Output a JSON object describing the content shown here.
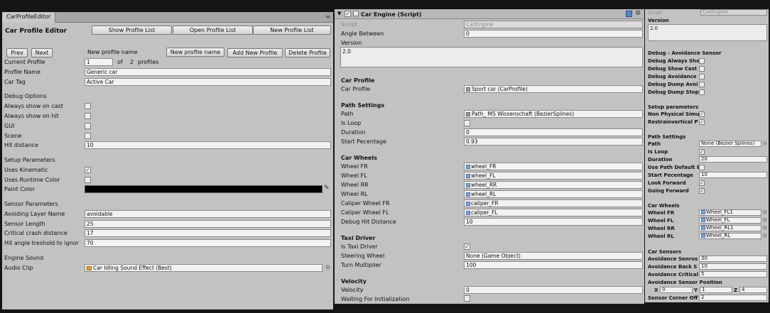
{
  "left": {
    "tab_title": "CarProfileEditor",
    "title": "Car Profile Editor",
    "buttons": {
      "show_list": "Show Profile List",
      "open_list": "Open Profile List",
      "new_list": "New Profile List",
      "prev": "Prev",
      "next": "Next",
      "new_name_field": "New profile name",
      "add_new": "Add New Profile",
      "delete": "Delete Profile"
    },
    "new_profile_name_label": "New profile name",
    "current_profile": {
      "label": "Current Profile",
      "value": "1",
      "of": "of",
      "total": "2",
      "suffix": "profiles"
    },
    "profile_name": {
      "label": "Profile Name",
      "value": "Generic car"
    },
    "car_tag": {
      "label": "Car Tag",
      "value": "Active Car"
    },
    "debug_header": "Debug Options",
    "debug": [
      {
        "label": "Always show on cast",
        "checked": false
      },
      {
        "label": "Always show on hit",
        "checked": false
      },
      {
        "label": "GUI",
        "checked": false
      },
      {
        "label": "Scene",
        "checked": false
      }
    ],
    "hit_distance": {
      "label": "Hit distance",
      "value": "10"
    },
    "setup_header": "Setup Parameters",
    "uses_kinematic": {
      "label": "Uses Kinematic",
      "checked": true
    },
    "uses_runtime_color": {
      "label": "Uses Runtime Color",
      "checked": false
    },
    "paint_color": {
      "label": "Paint Color",
      "color": "#000000"
    },
    "sensor_header": "Sensor Parameters",
    "sensor": [
      {
        "label": "Avoiding Layer Name",
        "value": "avoidable"
      },
      {
        "label": "Sensor Length",
        "value": "25"
      },
      {
        "label": "Critical crash distance",
        "value": "17"
      },
      {
        "label": "Hit angle treshold to ignor",
        "value": "70"
      }
    ],
    "engine_header": "Engine Sound",
    "audio_clip": {
      "label": "Audio Clip",
      "value": "Car Idling Sound Effect (Best)"
    }
  },
  "mid": {
    "component_title": "Car Engine (Script)",
    "script": {
      "label": "Script",
      "value": "CarEngine"
    },
    "angle_between": {
      "label": "Angle Between",
      "value": "0"
    },
    "version_label": "Version",
    "version_value": "2.0",
    "car_profile_header": "Car Profile",
    "car_profile": {
      "label": "Car Profile",
      "value": "Sport car (CarProfile)"
    },
    "path_header": "Path Settings",
    "path": {
      "label": "Path",
      "value": "Path_ MS Wissenschaft (BezierSplines)"
    },
    "is_loop": {
      "label": "Is Loop",
      "checked": false
    },
    "duration": {
      "label": "Duration",
      "value": "0"
    },
    "start_percentage": {
      "label": "Start Pecentage",
      "value": "0.93"
    },
    "wheels_header": "Car Wheels",
    "wheels": [
      {
        "label": "Wheel FR",
        "value": "wheel_FR"
      },
      {
        "label": "Wheel FL",
        "value": "wheel_FL"
      },
      {
        "label": "Wheel RR",
        "value": "wheel_RR"
      },
      {
        "label": "Wheel RL",
        "value": "wheel_RL"
      },
      {
        "label": "Caliper Wheel FR",
        "value": "caliper_FR"
      },
      {
        "label": "Caliper Wheel FL",
        "value": "caliper_FL"
      }
    ],
    "debug_hit_distance": {
      "label": "Debug Hit Distance",
      "value": "10"
    },
    "taxi_header": "Taxi Driver",
    "is_taxi_driver": {
      "label": "Is Taxi Driver",
      "checked": true
    },
    "steering_wheel": {
      "label": "Steering Wheel",
      "value": "None (Game Object)"
    },
    "turn_multiplier": {
      "label": "Turn Multiplier",
      "value": "100"
    },
    "velocity_header": "Velocity",
    "velocity": {
      "label": "Velocity",
      "value": "0"
    },
    "waiting_init": {
      "label": "Waiting For Initialization",
      "checked": false
    }
  },
  "right": {
    "script": {
      "label": "Script",
      "value": "CarEngine"
    },
    "version_label": "Version",
    "version_value": "2.0",
    "debug_header": "Debug - Avoidance Sensor",
    "debug": [
      {
        "label": "Debug Always Sho",
        "checked": false
      },
      {
        "label": "Debug Show Cast",
        "checked": false
      },
      {
        "label": "Debug Avoidance",
        "checked": false
      },
      {
        "label": "Debug Dump Avoi",
        "checked": false
      },
      {
        "label": "Debug Dump Stop",
        "checked": false
      }
    ],
    "setup_header": "Setup parameters",
    "non_physical": {
      "label": "Non Physical Simu",
      "checked": true
    },
    "restrain_vertical": {
      "label": "Restrainvertical P",
      "checked": true
    },
    "path_header": "Path Settings",
    "path": {
      "label": "Path",
      "value": "None (Bezier Splines)"
    },
    "is_loop": {
      "label": "Is Loop",
      "checked": true
    },
    "duration": {
      "label": "Duration",
      "value": "20"
    },
    "use_path_default": {
      "label": "Use Path Default E",
      "checked": false
    },
    "start_percentage": {
      "label": "Start Pecentage",
      "value": "10"
    },
    "look_forward": {
      "label": "Look Forward",
      "checked": true
    },
    "going_forward": {
      "label": "Going Forward",
      "checked": true
    },
    "wheels_header": "Car Wheels",
    "wheels": [
      {
        "label": "Wheel FR",
        "value": "Wheel_FL1"
      },
      {
        "label": "Wheel FL",
        "value": "Wheel_FL"
      },
      {
        "label": "Wheel RR",
        "value": "Wheel_RL1"
      },
      {
        "label": "Wheel RL",
        "value": "Wheel_RL"
      }
    ],
    "sensors_header": "Car Sensors",
    "avoid_sensor": {
      "label": "Avoidance Senros",
      "value": "30"
    },
    "avoid_back": {
      "label": "Avoidance Back S",
      "value": "10"
    },
    "avoid_critical": {
      "label": "Avoidance Critical",
      "value": "5"
    },
    "sensor_pos_label": "Avoidance Sensor Position",
    "pos": {
      "x_label": "X",
      "x": "0",
      "y_label": "Y",
      "y": "1",
      "z_label": "Z",
      "z": "4"
    },
    "corner_off": {
      "label": "Sensor Corner Off",
      "value": "2"
    }
  }
}
